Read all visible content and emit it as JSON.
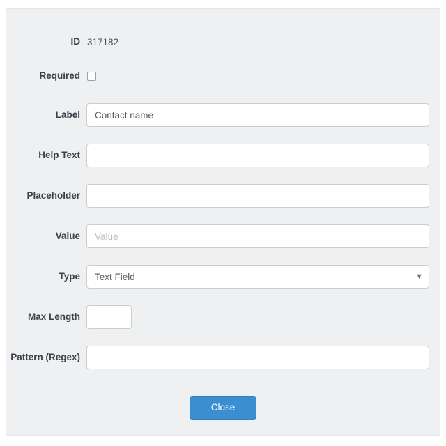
{
  "theme": {
    "panel_bg": "#eef0f2",
    "primary": "#3b8ed0",
    "label_color": "#3b4249",
    "input_border": "#cccccc"
  },
  "form": {
    "rows": [
      {
        "label": "ID",
        "control": "static",
        "value": "317182"
      },
      {
        "label": "Required",
        "control": "checkbox",
        "checked": false
      },
      {
        "label": "Label",
        "control": "text",
        "value": "Contact name",
        "placeholder": ""
      },
      {
        "label": "Help Text",
        "control": "text",
        "value": "",
        "placeholder": ""
      },
      {
        "label": "Placeholder",
        "control": "text",
        "value": "",
        "placeholder": ""
      },
      {
        "label": "Value",
        "control": "text",
        "value": "",
        "placeholder": "Value"
      },
      {
        "label": "Type",
        "control": "select",
        "value": "Text Field",
        "chevron": "chevron-down-icon"
      },
      {
        "label": "Max Length",
        "control": "text-narrow",
        "value": "",
        "placeholder": ""
      },
      {
        "label": "Pattern (Regex)",
        "control": "text",
        "value": "",
        "placeholder": ""
      }
    ]
  },
  "footer": {
    "close_label": "Close"
  }
}
